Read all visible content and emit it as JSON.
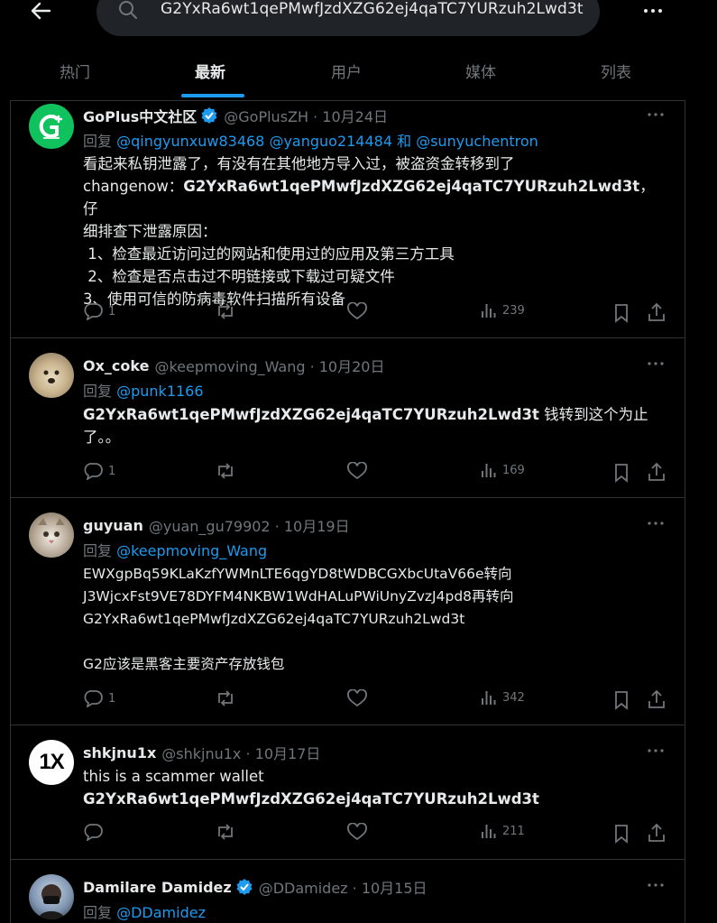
{
  "search": {
    "query": "G2YxRa6wt1qePMwfJzdXZG62ej4qaTC7YURzuh2Lwd3t"
  },
  "tabs": [
    {
      "label": "热门"
    },
    {
      "label": "最新"
    },
    {
      "label": "用户"
    },
    {
      "label": "媒体"
    },
    {
      "label": "列表"
    }
  ],
  "active_tab": "最新",
  "colors": {
    "accent": "#1d9bf0",
    "verified": "#1d9bf0",
    "goplus_green": "#10c25e"
  },
  "tweets": [
    {
      "name": "GoPlus中文社区",
      "verified": true,
      "handle": "@GoPlusZH · 10月24日",
      "reply_prefix": "回复",
      "mentions": "@qingyunxuw83468 @yanguo214484 和 @sunyuchentron",
      "lines": [
        "看起来私钥泄露了，有没有在其他地方导入过，被盗资金转移到了",
        "changenow：",
        "G2YxRa6wt1qePMwfJzdXZG62ej4qaTC7YURzuh2Lwd3t",
        "，仔",
        "细排查下泄露原因：",
        " 1、检查最近访问过的网站和使用过的应用及第三方工具",
        " 2、检查是否点击过不明链接或下载过可疑文件",
        "3、使用可信的防病毒软件扫描所有设备"
      ],
      "replies": "1",
      "views": "239"
    },
    {
      "name": "Ox_coke",
      "handle": "@keepmoving_Wang · 10月20日",
      "reply_prefix": "回复",
      "mentions": "@punk1166",
      "bold": "G2YxRa6wt1qePMwfJzdXZG62ej4qaTC7YURzuh2Lwd3t",
      "text_after": " 钱转到这个为止",
      "line2": "了。。",
      "replies": "1",
      "views": "169"
    },
    {
      "name": "guyuan",
      "handle": "@yuan_gu79902 · 10月19日",
      "reply_prefix": "回复",
      "mentions": "@keepmoving_Wang",
      "lines": [
        "EWXgpBq59KLaKzfYWMnLTE6qgYD8tWDBCGXbcUtaV66e转向",
        "J3WjcxFst9VE78DYFM4NKBW1WdHALuPWiUnyZvzJ4pd8再转向",
        "G2YxRa6wt1qePMwfJzdXZG62ej4qaTC7YURzuh2Lwd3t",
        "G2应该是黑客主要资产存放钱包"
      ],
      "replies": "1",
      "views": "342"
    },
    {
      "name": "shkjnu1x",
      "handle": "@shkjnu1x · 10月17日",
      "avatar_text": "1X",
      "lines": [
        "this is a scammer wallet",
        "G2YxRa6wt1qePMwfJzdXZG62ej4qaTC7YURzuh2Lwd3t"
      ],
      "replies": "",
      "views": "211"
    },
    {
      "name": "Damilare Damidez",
      "verified": true,
      "handle": "@DDamidez · 10月15日",
      "reply_prefix": "回复",
      "mentions": "@DDamidez"
    }
  ]
}
